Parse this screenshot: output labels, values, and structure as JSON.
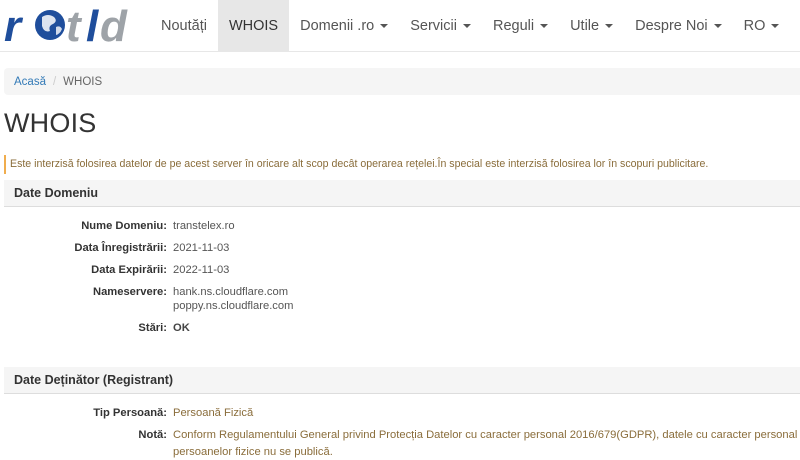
{
  "logo": {
    "text": "rotld"
  },
  "nav": {
    "items": [
      {
        "label": "Noutăți",
        "has_caret": false,
        "active": false
      },
      {
        "label": "WHOIS",
        "has_caret": false,
        "active": true
      },
      {
        "label": "Domenii .ro",
        "has_caret": true,
        "active": false
      },
      {
        "label": "Servicii",
        "has_caret": true,
        "active": false
      },
      {
        "label": "Reguli",
        "has_caret": true,
        "active": false
      },
      {
        "label": "Utile",
        "has_caret": true,
        "active": false
      },
      {
        "label": "Despre Noi",
        "has_caret": true,
        "active": false
      },
      {
        "label": "RO",
        "has_caret": true,
        "active": false
      }
    ]
  },
  "breadcrumb": {
    "home": "Acasă",
    "separator": "/",
    "current": "WHOIS"
  },
  "page": {
    "title": "WHOIS",
    "notice": "Este interzisă folosirea datelor de pe acest server în oricare alt scop decât operarea rețelei.În special este interzisă folosirea lor în scopuri publicitare."
  },
  "domain_section": {
    "heading": "Date Domeniu",
    "rows": [
      {
        "label": "Nume Domeniu:",
        "value": "transtelex.ro"
      },
      {
        "label": "Data Înregistrării:",
        "value": "2021-11-03"
      },
      {
        "label": "Data Expirării:",
        "value": "2022-11-03"
      },
      {
        "label": "Nameservere:",
        "value": "hank.ns.cloudflare.com",
        "value2": "poppy.ns.cloudflare.com"
      },
      {
        "label": "Stări:",
        "value": "OK"
      }
    ]
  },
  "registrant_section": {
    "heading": "Date Deținător (Registrant)",
    "rows": [
      {
        "label": "Tip Persoană:",
        "value": "Persoană Fizică"
      },
      {
        "label": "Notă:",
        "value": "Conform Regulamentului General privind Protecția Datelor cu caracter personal 2016/679(GDPR), datele cu caracter personal al persoanelor fizice nu se publică."
      }
    ]
  },
  "colors": {
    "link": "#337ab7",
    "notice_border": "#f0ad4e",
    "notice_text": "#8a6d3b",
    "logo_blue": "#1f4e9c",
    "logo_gray": "#9ea3a8"
  }
}
